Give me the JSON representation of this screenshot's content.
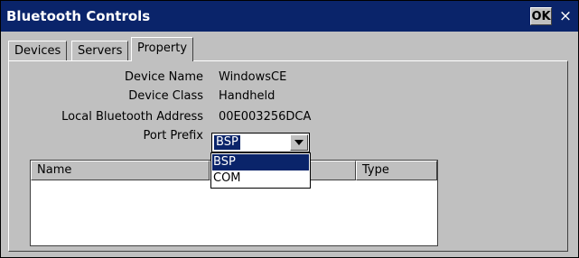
{
  "window": {
    "title": "Bluetooth Controls",
    "ok_label": "OK",
    "close_label": "×"
  },
  "tabs": [
    {
      "label": "Devices",
      "active": false
    },
    {
      "label": "Servers",
      "active": false
    },
    {
      "label": "Property",
      "active": true
    }
  ],
  "properties": [
    {
      "label": "Device Name",
      "value": "WindowsCE"
    },
    {
      "label": "Device Class",
      "value": "Handheld"
    },
    {
      "label": "Local Bluetooth Address",
      "value": "00E003256DCA"
    }
  ],
  "port_prefix": {
    "label": "Port Prefix",
    "selected": "BSP",
    "options": [
      "BSP",
      "COM"
    ],
    "dropdown_open": true
  },
  "list": {
    "columns": [
      "Name",
      "Type"
    ]
  },
  "colors": {
    "titlebar": "#0a246a",
    "selection": "#0a246a",
    "face": "#c0c0c0"
  }
}
